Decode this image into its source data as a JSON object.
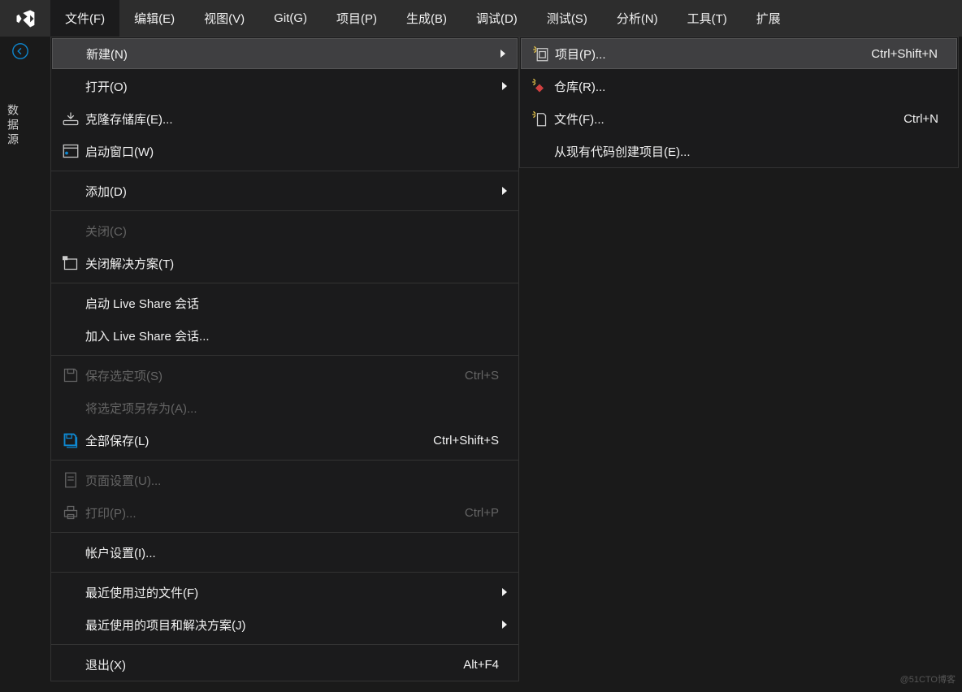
{
  "menubar": {
    "items": [
      "文件(F)",
      "编辑(E)",
      "视图(V)",
      "Git(G)",
      "项目(P)",
      "生成(B)",
      "调试(D)",
      "测试(S)",
      "分析(N)",
      "工具(T)",
      "扩展"
    ]
  },
  "sideTab": "数据源",
  "fileMenu": {
    "new": "新建(N)",
    "open": "打开(O)",
    "clone": "克隆存储库(E)...",
    "startWindow": "启动窗口(W)",
    "add": "添加(D)",
    "close": "关闭(C)",
    "closeSolution": "关闭解决方案(T)",
    "startLiveShare": "启动 Live Share 会话",
    "joinLiveShare": "加入 Live Share 会话...",
    "saveSelected": "保存选定项(S)",
    "saveSelectedShortcut": "Ctrl+S",
    "saveSelectedAs": "将选定项另存为(A)...",
    "saveAll": "全部保存(L)",
    "saveAllShortcut": "Ctrl+Shift+S",
    "pageSetup": "页面设置(U)...",
    "print": "打印(P)...",
    "printShortcut": "Ctrl+P",
    "accountSettings": "帐户设置(I)...",
    "recentFiles": "最近使用过的文件(F)",
    "recentProjects": "最近使用的项目和解决方案(J)",
    "exit": "退出(X)",
    "exitShortcut": "Alt+F4"
  },
  "newSubmenu": {
    "project": "项目(P)...",
    "projectShortcut": "Ctrl+Shift+N",
    "repo": "仓库(R)...",
    "file": "文件(F)...",
    "fileShortcut": "Ctrl+N",
    "fromExisting": "从现有代码创建项目(E)..."
  },
  "watermark": "@51CTO博客"
}
